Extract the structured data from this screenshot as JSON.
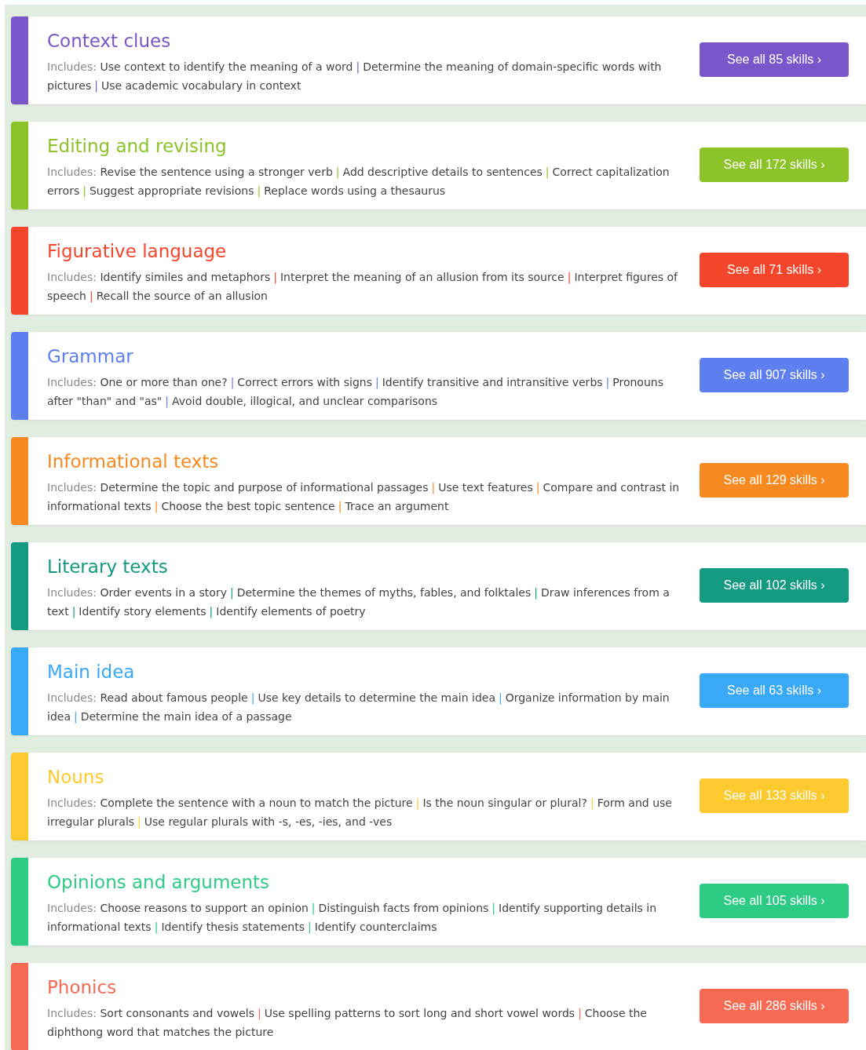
{
  "categories": [
    {
      "title": "Context clues",
      "color": "#7a56cb",
      "label": "Includes:",
      "separator": "|",
      "items": [
        "Use context to identify the meaning of a word",
        "Determine the meaning of domain-specific words with pictures",
        "Use academic vocabulary in context"
      ],
      "button": "See all 85 skills ›"
    },
    {
      "title": "Editing and revising",
      "color": "#8cc328",
      "label": "Includes:",
      "separator": "|",
      "items": [
        "Revise the sentence using a stronger verb",
        "Add descriptive details to sentences",
        "Correct capitalization errors",
        "Suggest appropriate revisions",
        "Replace words using a thesaurus"
      ],
      "button": "See all 172 skills ›"
    },
    {
      "title": "Figurative language",
      "color": "#f5452a",
      "label": "Includes:",
      "separator": "|",
      "items": [
        "Identify similes and metaphors",
        "Interpret the meaning of an allusion from its source",
        "Interpret figures of speech",
        "Recall the source of an allusion"
      ],
      "button": "See all 71 skills ›"
    },
    {
      "title": "Grammar",
      "color": "#5d7ff0",
      "label": "Includes:",
      "separator": "|",
      "items": [
        "One or more than one?",
        "Correct errors with signs",
        "Identify transitive and intransitive verbs",
        "Pronouns after \"than\" and \"as\"",
        "Avoid double, illogical, and unclear comparisons"
      ],
      "button": "See all 907 skills ›"
    },
    {
      "title": "Informational texts",
      "color": "#f68a20",
      "label": "Includes:",
      "separator": "|",
      "items": [
        "Determine the topic and purpose of informational passages",
        "Use text features",
        "Compare and contrast in informational texts",
        "Choose the best topic sentence",
        "Trace an argument"
      ],
      "button": "See all 129 skills ›"
    },
    {
      "title": "Literary texts",
      "color": "#139a80",
      "label": "Includes:",
      "separator": "|",
      "items": [
        "Order events in a story",
        "Determine the themes of myths, fables, and folktales",
        "Draw inferences from a text",
        "Identify story elements",
        "Identify elements of poetry"
      ],
      "button": "See all 102 skills ›"
    },
    {
      "title": "Main idea",
      "color": "#38a8f7",
      "label": "Includes:",
      "separator": "|",
      "items": [
        "Read about famous people",
        "Use key details to determine the main idea",
        "Organize information by main idea",
        "Determine the main idea of a passage"
      ],
      "button": "See all 63 skills ›"
    },
    {
      "title": "Nouns",
      "color": "#fcca2e",
      "label": "Includes:",
      "separator": "|",
      "items": [
        "Complete the sentence with a noun to match the picture",
        "Is the noun singular or plural?",
        "Form and use irregular plurals",
        "Use regular plurals with -s, -es, -ies, and -ves"
      ],
      "button": "See all 133 skills ›"
    },
    {
      "title": "Opinions and arguments",
      "color": "#2ecb85",
      "label": "Includes:",
      "separator": "|",
      "items": [
        "Choose reasons to support an opinion",
        "Distinguish facts from opinions",
        "Identify supporting details in informational texts",
        "Identify thesis statements",
        "Identify counterclaims"
      ],
      "button": "See all 105 skills ›"
    },
    {
      "title": "Phonics",
      "color": "#f66a54",
      "label": "Includes:",
      "separator": "|",
      "items": [
        "Sort consonants and vowels",
        "Use spelling patterns to sort long and short vowel words",
        "Choose the diphthong word that matches the picture"
      ],
      "button": "See all 286 skills ›"
    }
  ]
}
